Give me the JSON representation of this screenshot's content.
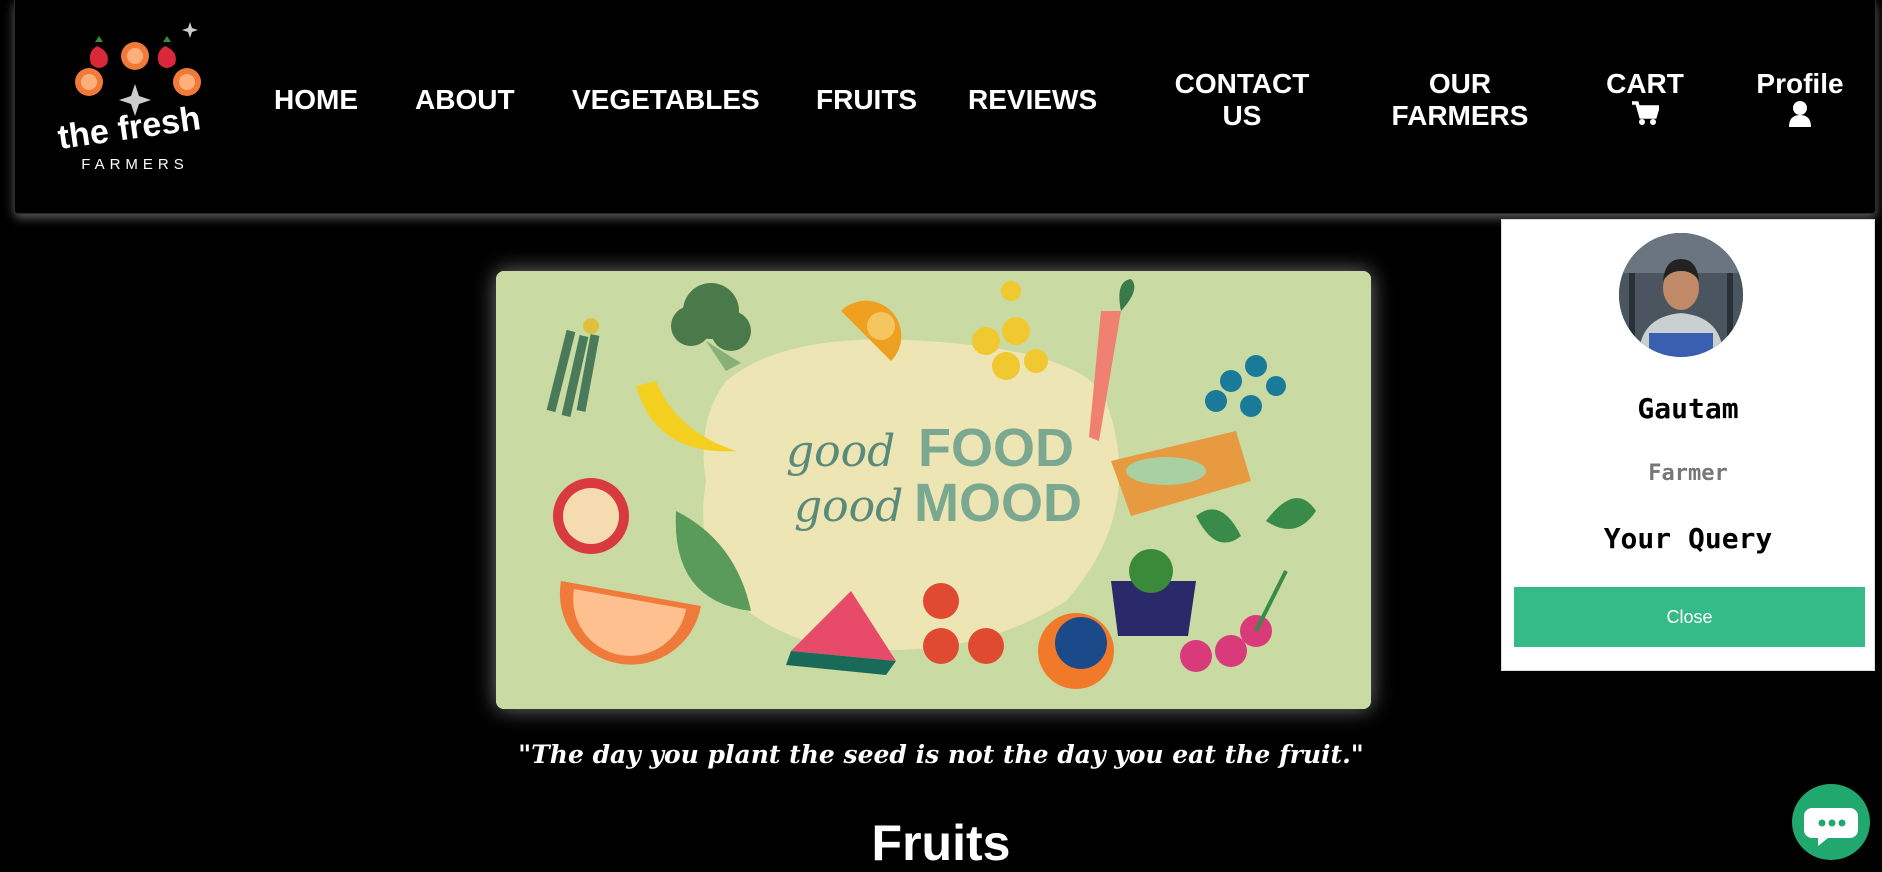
{
  "logo": {
    "line1": "the fresh",
    "line2": "FARMERS"
  },
  "nav": {
    "home": "HOME",
    "about": "ABOUT",
    "vegetables": "VEGETABLES",
    "fruits": "FRUITS",
    "reviews": "REVIEWS",
    "contact_line1": "CONTACT",
    "contact_line2": "US",
    "farmers_line1": "OUR",
    "farmers_line2": "FARMERS",
    "cart": "CART",
    "profile": "Profile"
  },
  "profile_card": {
    "name": "Gautam",
    "role": "Farmer",
    "query_label": "Your Query",
    "close_label": "Close"
  },
  "banner": {
    "good1": "good",
    "food": "FOOD",
    "good2": "good",
    "mood": "MOOD"
  },
  "quote": "\"The day you plant the seed is not the day you eat the fruit.\"",
  "section_title": "Fruits",
  "colors": {
    "accent_green": "#35bb87",
    "chat_green": "#20a86e",
    "banner_bg": "#c9dba2"
  }
}
